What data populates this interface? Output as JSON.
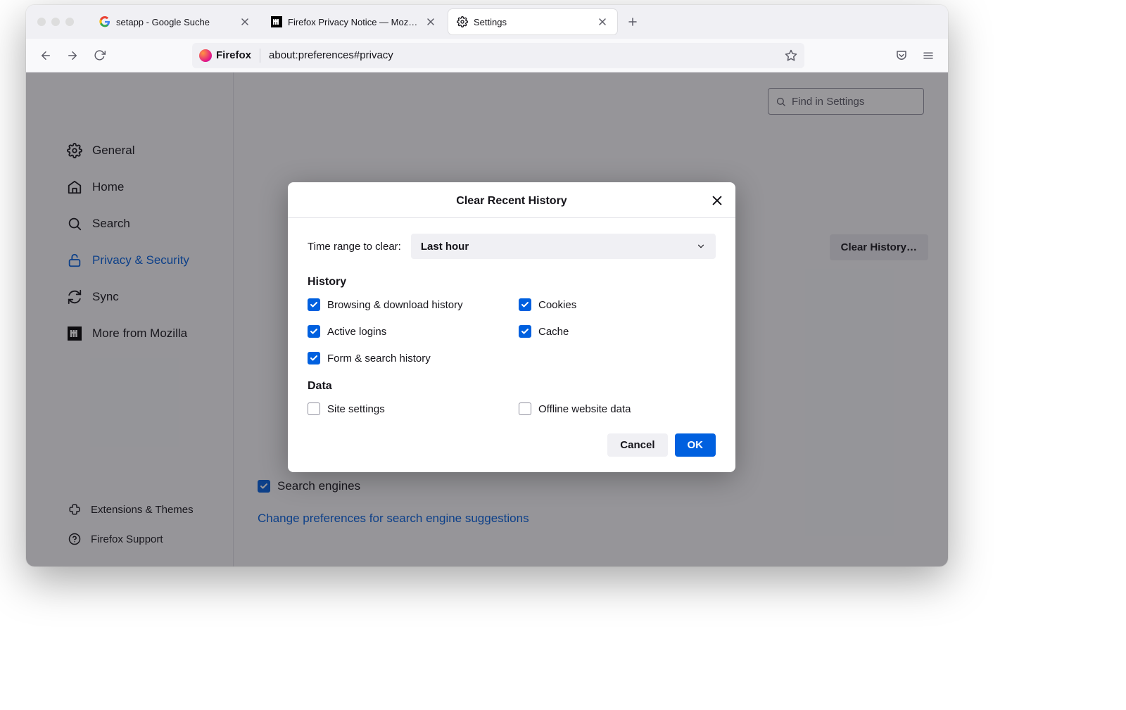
{
  "tabs": [
    {
      "title": "setapp - Google Suche",
      "icon": "google"
    },
    {
      "title": "Firefox Privacy Notice — Mozilla",
      "icon": "mozilla"
    },
    {
      "title": "Settings",
      "icon": "gear",
      "active": true
    }
  ],
  "urlbar": {
    "badge": "Firefox",
    "url": "about:preferences#privacy"
  },
  "sidebar": {
    "items": [
      {
        "label": "General"
      },
      {
        "label": "Home"
      },
      {
        "label": "Search"
      },
      {
        "label": "Privacy & Security",
        "active": true
      },
      {
        "label": "Sync"
      },
      {
        "label": "More from Mozilla"
      }
    ],
    "bottom": [
      {
        "label": "Extensions & Themes"
      },
      {
        "label": "Firefox Support"
      }
    ]
  },
  "main": {
    "search_placeholder": "Find in Settings",
    "clear_history_btn": "Clear History…",
    "search_engines_label": "Search engines",
    "suggestions_link": "Change preferences for search engine suggestions"
  },
  "dialog": {
    "title": "Clear Recent History",
    "range_label": "Time range to clear:",
    "range_value": "Last hour",
    "history_heading": "History",
    "history_items": [
      {
        "label": "Browsing & download history",
        "checked": true
      },
      {
        "label": "Cookies",
        "checked": true
      },
      {
        "label": "Active logins",
        "checked": true
      },
      {
        "label": "Cache",
        "checked": true
      },
      {
        "label": "Form & search history",
        "checked": true
      }
    ],
    "data_heading": "Data",
    "data_items": [
      {
        "label": "Site settings",
        "checked": false
      },
      {
        "label": "Offline website data",
        "checked": false
      }
    ],
    "cancel": "Cancel",
    "ok": "OK"
  }
}
